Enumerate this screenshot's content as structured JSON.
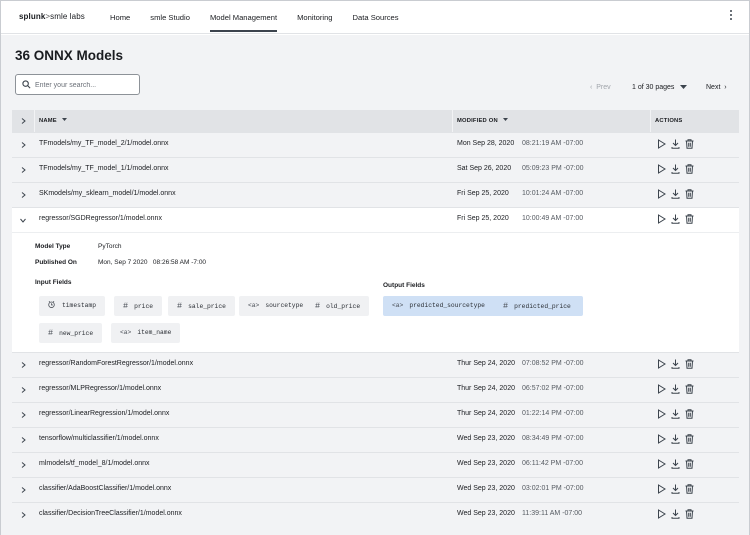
{
  "header": {
    "logo_brand": "splunk",
    "logo_sep": ">",
    "logo_product": "smle labs",
    "nav": [
      {
        "label": "Home"
      },
      {
        "label": "smle Studio"
      },
      {
        "label": "Model Management",
        "active": true
      },
      {
        "label": "Monitoring"
      },
      {
        "label": "Data Sources"
      }
    ]
  },
  "page": {
    "title": "36 ONNX Models"
  },
  "search": {
    "placeholder": "Enter your search..."
  },
  "pager": {
    "prev": "Prev",
    "pages": "1 of 30 pages",
    "next": "Next"
  },
  "table": {
    "columns": {
      "name": "NAME",
      "modified": "MODIFIED ON",
      "actions": "ACTIONS"
    },
    "rows_top": [
      {
        "name": "TFmodels/my_TF_model_2/1/model.onnx",
        "date": "Mon Sep 28, 2020",
        "time": "08:21:19 AM -07:00"
      },
      {
        "name": "TFmodels/my_TF_model_1/1/model.onnx",
        "date": "Sat Sep 26, 2020",
        "time": "05:09:23 PM -07:00"
      },
      {
        "name": "SKmodels/my_sklearn_model/1/model.onnx",
        "date": "Fri Sep 25, 2020",
        "time": "10:01:24 AM -07:00"
      }
    ],
    "expanded_row": {
      "name": "regressor/SGDRegressor/1/model.onnx",
      "date": "Fri Sep 25, 2020",
      "time": "10:00:49 AM -07:00"
    },
    "rows_bottom": [
      {
        "name": "regressor/RandomForestRegressor/1/model.onnx",
        "date": "Thur Sep 24, 2020",
        "time": "07:08:52 PM -07:00"
      },
      {
        "name": "regressor/MLPRegressor/1/model.onnx",
        "date": "Thur Sep 24, 2020",
        "time": "06:57:02 PM -07:00"
      },
      {
        "name": "regressor/LinearRegression/1/model.onnx",
        "date": "Thur Sep 24, 2020",
        "time": "01:22:14 PM -07:00"
      },
      {
        "name": "tensorflow/multiclassifier/1/model.onnx",
        "date": "Wed Sep 23, 2020",
        "time": "08:34:49 PM -07:00"
      },
      {
        "name": "mlmodels/tf_model_8/1/model.onnx",
        "date": "Wed Sep 23, 2020",
        "time": "06:11:42 PM -07:00"
      },
      {
        "name": "classifier/AdaBoostClassifier/1/model.onnx",
        "date": "Wed Sep 23, 2020",
        "time": "03:02:01 PM -07:00"
      },
      {
        "name": "classifier/DecisionTreeClassifier/1/model.onnx",
        "date": "Wed Sep 23, 2020",
        "time": "11:39:11 AM -07:00"
      }
    ]
  },
  "details": {
    "model_type_label": "Model Type",
    "model_type_value": "PyTorch",
    "published_label": "Published On",
    "published_value": "Mon, Sep 7 2020   08:26:58 AM -7:00",
    "input_label": "Input Fields",
    "output_label": "Output Fields",
    "input_fields": [
      {
        "icon": "clock-icon",
        "name": "timestamp"
      },
      {
        "icon": "hash-icon",
        "glyph": "#",
        "name": "price"
      },
      {
        "icon": "hash-icon",
        "glyph": "#",
        "name": "sale_price"
      },
      {
        "icon": "string-icon",
        "glyph": "<a>",
        "name": "sourcetype"
      },
      {
        "icon": "hash-icon",
        "glyph": "#",
        "name": "old_price"
      },
      {
        "icon": "hash-icon",
        "glyph": "#",
        "name": "new_price"
      },
      {
        "icon": "string-icon",
        "glyph": "<a>",
        "name": "item_name"
      }
    ],
    "output_fields": [
      {
        "icon": "string-icon",
        "glyph": "<a>",
        "name": "predicted_sourcetype"
      },
      {
        "icon": "hash-icon",
        "glyph": "#",
        "name": "predicted_price"
      }
    ]
  }
}
